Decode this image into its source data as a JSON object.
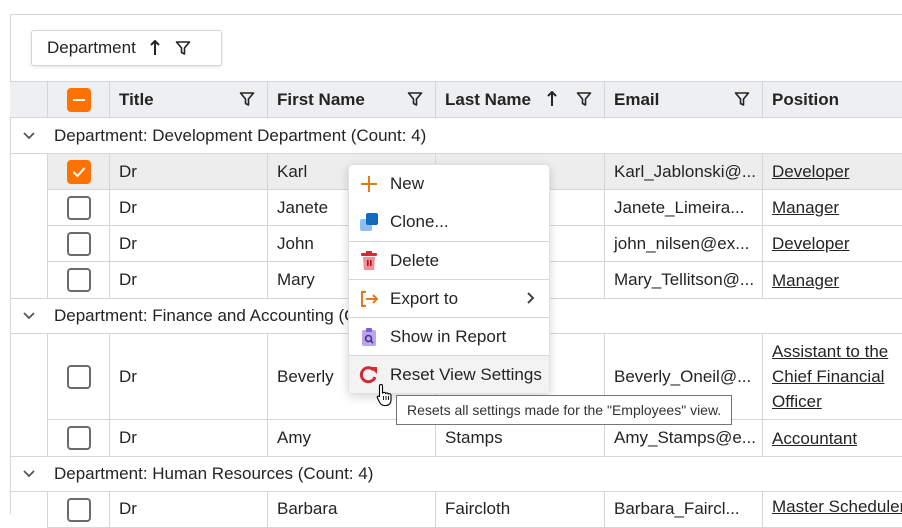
{
  "group_panel": {
    "label": "Department",
    "sort": "ascending"
  },
  "columns": [
    {
      "key": "title",
      "label": "Title",
      "filter": true,
      "sort": null
    },
    {
      "key": "first",
      "label": "First Name",
      "filter": true,
      "sort": null
    },
    {
      "key": "last",
      "label": "Last Name",
      "filter": true,
      "sort": "ascending"
    },
    {
      "key": "email",
      "label": "Email",
      "filter": true,
      "sort": null
    },
    {
      "key": "position",
      "label": "Position",
      "filter": false,
      "sort": null
    }
  ],
  "groups": [
    {
      "label": "Department: Development Department (Count: 4)",
      "rows": [
        {
          "selected": true,
          "title": "Dr",
          "first": "Karl",
          "last": "",
          "email": "Karl_Jablonski@...",
          "position": "Developer"
        },
        {
          "selected": false,
          "title": "Dr",
          "first": "Janete",
          "last": "",
          "email": "Janete_Limeira...",
          "position": "Manager"
        },
        {
          "selected": false,
          "title": "Dr",
          "first": "John",
          "last": "",
          "email": "john_nilsen@ex...",
          "position": "Developer"
        },
        {
          "selected": false,
          "title": "Dr",
          "first": "Mary",
          "last": "",
          "email": "Mary_Tellitson@...",
          "position": "Manager"
        }
      ]
    },
    {
      "label": "Department: Finance and Accounting (Count: 2)",
      "rows": [
        {
          "selected": false,
          "title": "Dr",
          "first": "Beverly",
          "last": "",
          "email": "Beverly_Oneil@...",
          "position": "Assistant to the Chief Financial Officer"
        },
        {
          "selected": false,
          "title": "Dr",
          "first": "Amy",
          "last": "Stamps",
          "email": "Amy_Stamps@e...",
          "position": "Accountant"
        }
      ]
    },
    {
      "label": "Department: Human Resources (Count: 4)",
      "rows": [
        {
          "selected": false,
          "title": "Dr",
          "first": "Barbara",
          "last": "Faircloth",
          "email": "Barbara_Faircl...",
          "position": "Master Scheduler"
        }
      ]
    }
  ],
  "context_menu": {
    "items": [
      {
        "label": "New",
        "icon": "plus-icon"
      },
      {
        "label": "Clone...",
        "icon": "clone-icon"
      },
      {
        "label": "Delete",
        "icon": "trash-icon"
      },
      {
        "label": "Export to",
        "icon": "export-icon",
        "submenu": true
      },
      {
        "label": "Show in Report",
        "icon": "report-icon"
      },
      {
        "label": "Reset View Settings",
        "icon": "reset-icon",
        "hovered": true
      }
    ]
  },
  "tooltip": "Resets all settings made for the \"Employees\" view.",
  "colors": {
    "accent": "#ff7200",
    "header_bg": "#eeeff1",
    "border": "#d4d6da",
    "delete": "#d42a36",
    "clone": "#0f6cbd",
    "report": "#8a6fd0"
  }
}
